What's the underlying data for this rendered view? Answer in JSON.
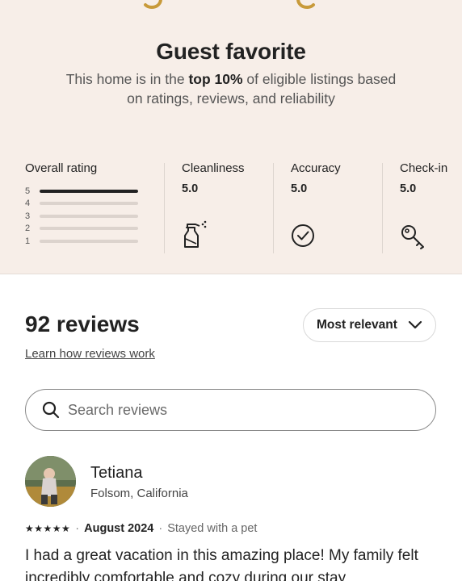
{
  "hero": {
    "title": "Guest favorite",
    "subtitle_before": "This home is in the ",
    "subtitle_bold": "top 10%",
    "subtitle_after": " of eligible listings based on ratings, reviews, and reliability",
    "laurel_left_icon": "laurel-left-icon",
    "laurel_right_icon": "laurel-right-icon"
  },
  "overall_rating": {
    "label": "Overall rating",
    "bars": [
      {
        "star": "5",
        "fill": 1.0
      },
      {
        "star": "4",
        "fill": 0.0
      },
      {
        "star": "3",
        "fill": 0.0
      },
      {
        "star": "2",
        "fill": 0.0
      },
      {
        "star": "1",
        "fill": 0.0
      }
    ]
  },
  "categories": [
    {
      "label": "Cleanliness",
      "value": "5.0",
      "icon": "spray-bottle-icon"
    },
    {
      "label": "Accuracy",
      "value": "5.0",
      "icon": "check-circle-icon"
    },
    {
      "label": "Check-in",
      "value": "5.0",
      "icon": "key-icon"
    }
  ],
  "reviews": {
    "count_label": "92 reviews",
    "learn_link": "Learn how reviews work",
    "sort_label": "Most relevant",
    "sort_icon": "chevron-down-icon",
    "search_placeholder": "Search reviews",
    "search_value": "",
    "search_icon": "search-icon"
  },
  "review": {
    "name": "Tetiana",
    "location": "Folsom, California",
    "stars": "★★★★★",
    "rating": 5,
    "date": "August 2024",
    "extra": "Stayed with a pet",
    "text": "I had a great vacation in this amazing place! My family felt incredibly comfortable and cozy during our stay"
  },
  "colors": {
    "hero_bg": "#f7eee8",
    "text": "#222222",
    "muted": "#555555"
  }
}
